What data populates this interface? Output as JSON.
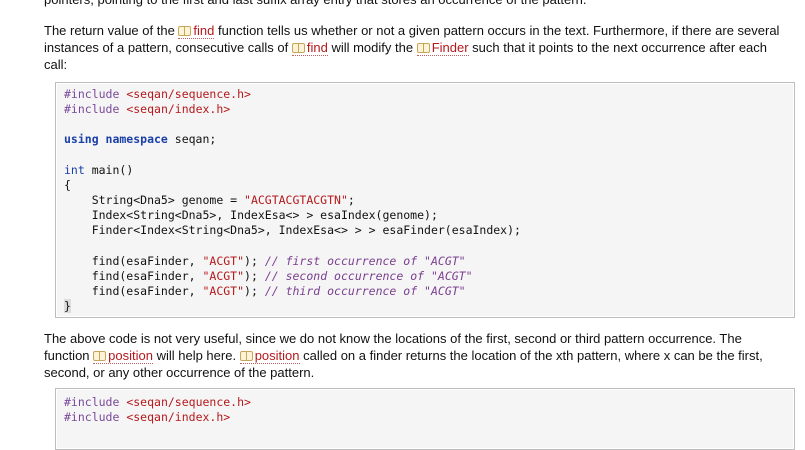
{
  "top_fragment": "pointers, pointing to the first and last suffix array entry that stores an occurrence of the pattern.",
  "paragraph1": {
    "t1": "The return value of the ",
    "link1": "find",
    "t2": " function tells us whether or not a given pattern occurs in the text. Furthermore, if there are several instances of a pattern, consecutive calls of ",
    "link2": "find",
    "t3": " will modify the ",
    "link3": "Finder",
    "t4": " such that it points to the next occurrence after each call:"
  },
  "code1": {
    "include1_kw": "#include",
    "include1_hdr": "<seqan/sequence.h>",
    "include2_kw": "#include",
    "include2_hdr": "<seqan/index.h>",
    "using_kw": "using namespace",
    "using_ns": " seqan;",
    "main_type": "int",
    "main_rest": " main()",
    "open_brace": "{",
    "l_genome_a": "    String<Dna5> genome = ",
    "l_genome_str": "\"ACGTACGTACGTN\"",
    "l_genome_b": ";",
    "l_index": "    Index<String<Dna5>, IndexEsa<> > esaIndex(genome);",
    "l_finder": "    Finder<Index<String<Dna5>, IndexEsa<> > > esaFinder(esaIndex);",
    "find_prefix": "    find(esaFinder, ",
    "find_str": "\"ACGT\"",
    "find_mid": "); ",
    "cmt1": "// first occurrence of \"ACGT\"",
    "cmt2": "// second occurrence of \"ACGT\"",
    "cmt3": "// third occurrence of \"ACGT\"",
    "close_brace": "}"
  },
  "paragraph2": {
    "t1": "The above code is not very useful, since we do not know the locations of the first, second or third pattern occurrence. The function ",
    "link1": "position",
    "t2": " will help here. ",
    "link2": "position",
    "t3": " called on a finder returns the location of the xth pattern, where x can be the first, second, or any other occurrence of the pattern."
  },
  "code2": {
    "include1_kw": "#include",
    "include1_hdr": "<seqan/sequence.h>",
    "include2_kw": "#include",
    "include2_hdr": "<seqan/index.h>"
  },
  "colors": {
    "link": "#b5191c",
    "keyword": "#1a3fa8",
    "comment": "#7b3f8f",
    "code_bg": "#f5f5f5"
  }
}
